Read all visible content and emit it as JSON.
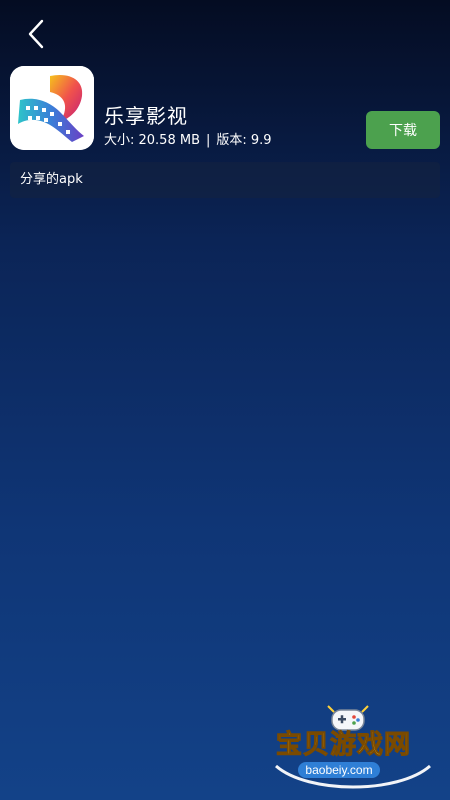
{
  "header": {
    "back_icon": "chevron-left-icon"
  },
  "app": {
    "name": "乐享影视",
    "size_label": "大小: 20.58 MB",
    "separator": "|",
    "version_label": "版本: 9.9",
    "icon": "film-strip-app-icon",
    "download_label": "下载",
    "download_color": "#4ca14e"
  },
  "description": {
    "text": "分享的apk"
  },
  "watermark": {
    "title": "宝贝游戏网",
    "url": "baobeiy.com",
    "icon": "gamepad-icon"
  }
}
